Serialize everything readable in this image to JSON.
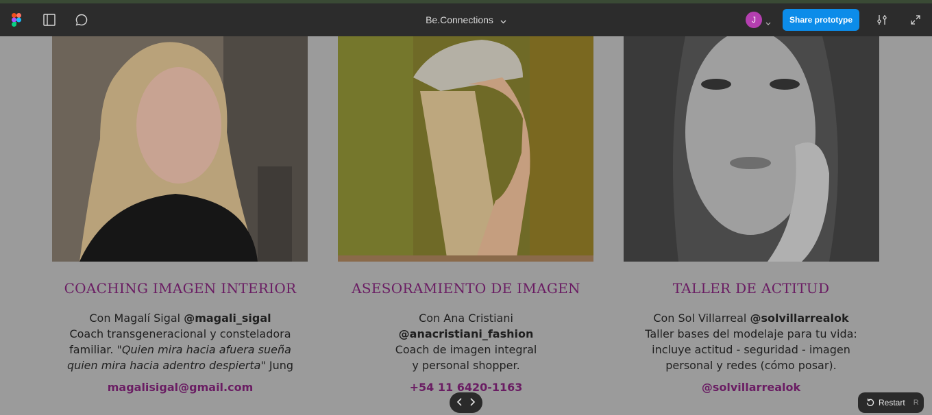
{
  "toolbar": {
    "file_title": "Be.Connections",
    "icons": [
      "figma-logo-icon",
      "sidebar-toggle-icon",
      "comment-icon",
      "chevron-down-icon",
      "settings-sliders-icon",
      "expand-icon"
    ],
    "avatar_initial": "J",
    "share_label": "Share prototype",
    "colors": {
      "bar": "#2c2c2c",
      "share": "#0c8ce9",
      "avatar": "#b43fb0"
    }
  },
  "cards": [
    {
      "title": "COACHING IMAGEN INTERIOR",
      "line1_prefix": "Con Magalí Sigal ",
      "line1_handle": "@magali_sigal",
      "line2": "Coach transgeneracional y consteladora",
      "line3_prefix": "familiar. ",
      "line3_quote": "\"Quien mira hacia afuera sueña",
      "line4_quote": "quien mira hacia adentro despierta\"",
      "line4_suffix": " Jung",
      "link": "magalisigal@gmail.com"
    },
    {
      "title": "ASESORAMIENTO DE IMAGEN",
      "line1": "Con Ana Cristiani",
      "line2_handle": "@anacristiani_fashion",
      "line3": "Coach de imagen integral",
      "line4": "y personal shopper.",
      "link": "+54 11 6420-1163"
    },
    {
      "title": "TALLER DE ACTITUD",
      "line1_prefix": "Con Sol Villarreal ",
      "line1_handle": "@solvillarrealok",
      "line2": "Taller bases del modelaje para tu vida:",
      "line3": "incluye actitud - seguridad - imagen",
      "line4": "personal y redes (cómo posar).",
      "link": "@solvillarrealok"
    }
  ],
  "player": {
    "restart_label": "Restart",
    "restart_key": "R"
  },
  "accent_color": "#6a1d63"
}
